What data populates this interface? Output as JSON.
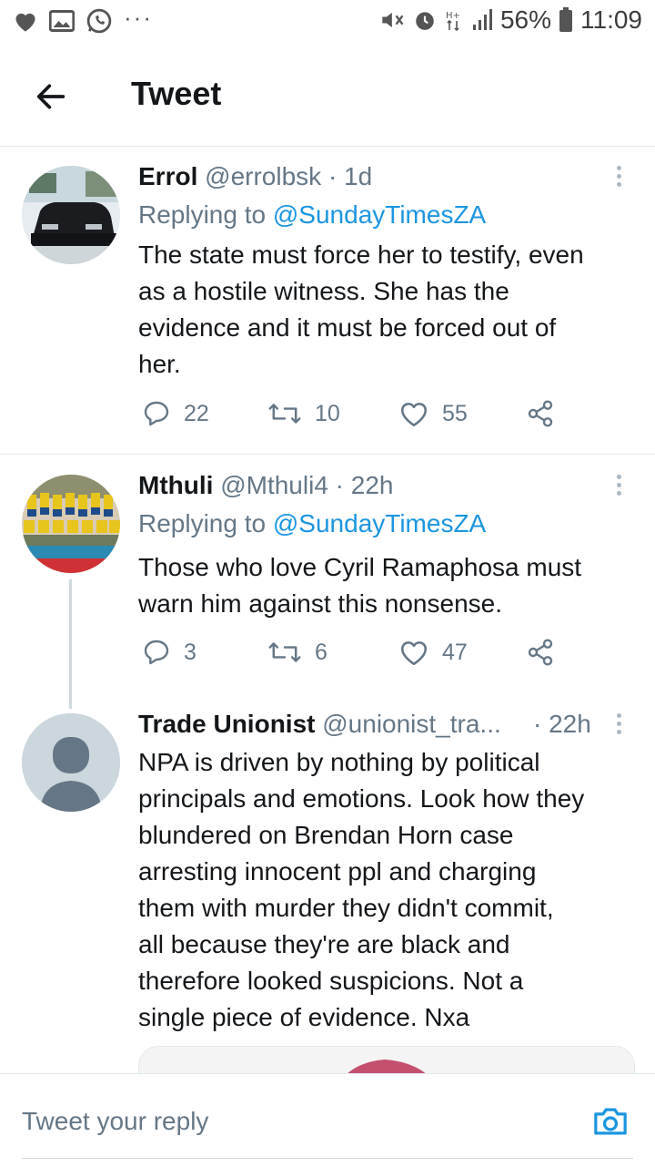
{
  "status_bar": {
    "battery": "56%",
    "time": "11:09",
    "network_label": "H+",
    "overflow": "···"
  },
  "header": {
    "title": "Tweet"
  },
  "tweets": [
    {
      "name": "Errol",
      "handle": "@errolbsk",
      "time": "· 1d",
      "replying_prefix": "Replying to ",
      "replying_to": "@SundayTimesZA",
      "lines": [
        "The state must force her to testify, even",
        "as a hostile witness. She has the",
        "evidence and it must be forced out of",
        "her."
      ],
      "replies": "22",
      "retweets": "10",
      "likes": "55"
    },
    {
      "name": "Mthuli",
      "handle": "@Mthuli4",
      "time": "· 22h",
      "replying_prefix": "Replying to ",
      "replying_to": "@SundayTimesZA",
      "lines": [
        "Those who love Cyril Ramaphosa must",
        "warn him against this nonsense."
      ],
      "replies": "3",
      "retweets": "6",
      "likes": "47"
    },
    {
      "name": "Trade Unionist",
      "handle": "@unionist_tra...",
      "time": "· 22h",
      "lines": [
        "NPA is driven by nothing by political",
        "principals and emotions. Look how they",
        "blundered on Brendan Horn case",
        "arresting innocent ppl and charging",
        "them with murder they didn't commit,",
        "all because they're are black and",
        "therefore looked suspicions. Not a",
        "single piece of evidence. Nxa"
      ]
    }
  ],
  "reply_bar": {
    "placeholder": "Tweet your reply"
  },
  "colors": {
    "link": "#1b95e0",
    "secondary_text": "#657786",
    "primary_text": "#14171a",
    "divider": "#e1e8ed"
  },
  "icons": {
    "back": "arrow-left-icon",
    "more": "vertical-dots-icon",
    "reply": "speech-bubble-icon",
    "retweet": "retweet-icon",
    "like": "heart-icon",
    "share": "share-icon",
    "camera": "camera-icon"
  }
}
